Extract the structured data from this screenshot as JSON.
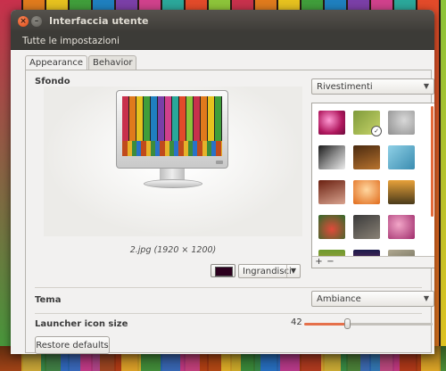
{
  "window": {
    "title": "Interfaccia utente",
    "close_icon": "close-icon",
    "minimize_icon": "minimize-icon"
  },
  "menubar": {
    "item": "Tutte le impostazioni"
  },
  "tabs": [
    {
      "label": "Appearance",
      "active": true
    },
    {
      "label": "Behavior",
      "active": false
    }
  ],
  "background": {
    "section_label": "Sfondo",
    "source_select": "Rivestimenti",
    "caption": "2.jpg (1920 × 1200)",
    "color": "#2c001e",
    "scale_select": "Ingrandisci",
    "gallery_add": "+",
    "gallery_remove": "−",
    "selected_thumbnail": 2
  },
  "theme": {
    "label": "Tema",
    "value": "Ambiance"
  },
  "launcher": {
    "label": "Launcher icon size",
    "value": "42",
    "level": 0.33
  },
  "restore_button": "Restore defaults",
  "colors": {
    "accent": "#e5704a",
    "titlebar": "#3c3b37"
  }
}
